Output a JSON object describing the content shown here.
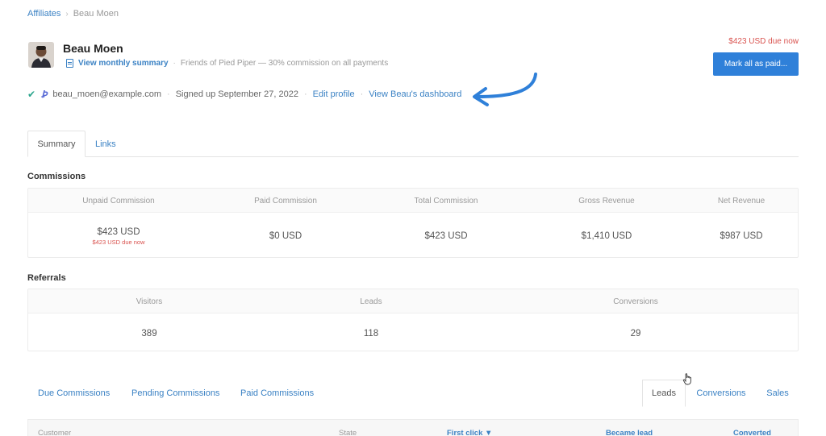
{
  "breadcrumb": {
    "parent": "Affiliates",
    "separator": "›",
    "current": "Beau Moen"
  },
  "profile": {
    "name": "Beau Moen",
    "summary_link": "View monthly summary",
    "program": "Friends of Pied Piper — 30% commission on all payments",
    "email": "beau_moen@example.com",
    "signed_up": "Signed up September 27, 2022",
    "edit_link": "Edit profile",
    "dashboard_link": "View Beau's dashboard",
    "verified_icon": "check-icon",
    "stripe_icon": "stripe-icon"
  },
  "actions": {
    "due_label": "$423 USD due now",
    "mark_paid": "Mark all as paid..."
  },
  "tabs": [
    {
      "label": "Summary"
    },
    {
      "label": "Links"
    }
  ],
  "commissions": {
    "title": "Commissions",
    "columns": [
      {
        "label": "Unpaid Commission",
        "value": "$423 USD",
        "sub": "$423 USD due now"
      },
      {
        "label": "Paid Commission",
        "value": "$0 USD"
      },
      {
        "label": "Total Commission",
        "value": "$423 USD"
      },
      {
        "label": "Gross Revenue",
        "value": "$1,410 USD"
      },
      {
        "label": "Net Revenue",
        "value": "$987 USD"
      }
    ]
  },
  "referrals": {
    "title": "Referrals",
    "columns": [
      {
        "label": "Visitors",
        "value": "389"
      },
      {
        "label": "Leads",
        "value": "118"
      },
      {
        "label": "Conversions",
        "value": "29"
      }
    ]
  },
  "commission_tabs": [
    "Due Commissions",
    "Pending Commissions",
    "Paid Commissions"
  ],
  "activity_tabs": [
    "Leads",
    "Conversions",
    "Sales"
  ],
  "table_headers": {
    "customer": "Customer",
    "state": "State",
    "first_click": "First click ▼",
    "became_lead": "Became lead",
    "converted": "Converted"
  },
  "colors": {
    "accent": "#2f80d9",
    "link": "#3b82c4",
    "danger": "#d9534f"
  }
}
